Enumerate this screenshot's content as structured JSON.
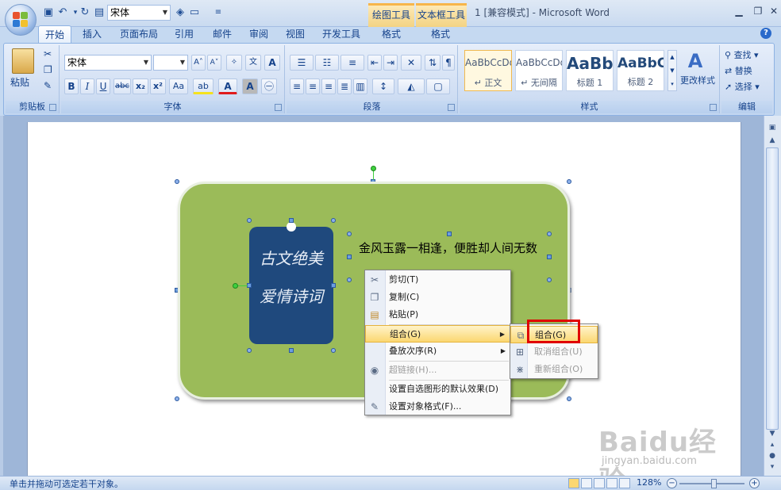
{
  "window": {
    "title": "1 [兼容模式] - Microsoft Word",
    "controls": [
      "minimize",
      "restore",
      "close"
    ]
  },
  "quick_access": {
    "font_value": "宋体"
  },
  "contextual_tools": {
    "drawing_tools": "绘图工具",
    "textbox_tools": "文本框工具",
    "format_label_1": "格式",
    "format_label_2": "格式"
  },
  "tabs": [
    "开始",
    "插入",
    "页面布局",
    "引用",
    "邮件",
    "审阅",
    "视图",
    "开发工具"
  ],
  "ribbon": {
    "clipboard": {
      "paste_label": "粘贴",
      "group_label": "剪贴板"
    },
    "font": {
      "font_name": "宋体",
      "font_size": "",
      "group_label": "字体",
      "bold": "B",
      "italic": "I",
      "underline": "U",
      "strike": "abc",
      "subscript": "x₂",
      "superscript": "x²",
      "change_case": "Aa",
      "font_color": "A",
      "char_shading": "A"
    },
    "paragraph": {
      "group_label": "段落"
    },
    "styles": {
      "group_label": "样式",
      "items": [
        {
          "sample": "AaBbCcDd",
          "name": "↵ 正文"
        },
        {
          "sample": "AaBbCcDd",
          "name": "↵ 无间隔"
        },
        {
          "sample": "AaBb",
          "name": "标题 1"
        },
        {
          "sample": "AaBbC",
          "name": "标题 2"
        }
      ],
      "change_styles": "更改样式"
    },
    "editing": {
      "group_label": "编辑",
      "find": "查找",
      "replace": "替换",
      "select": "选择"
    }
  },
  "document": {
    "poem_line_1": "古文绝美",
    "poem_line_2": "爱情诗词",
    "textbox_text": "金风玉露一相逢，便胜却人间无数"
  },
  "context_menu": {
    "items": [
      {
        "label": "剪切(T)",
        "icon": "cut-icon",
        "enabled": true,
        "submenu": false
      },
      {
        "label": "复制(C)",
        "icon": "copy-icon",
        "enabled": true,
        "submenu": false
      },
      {
        "label": "粘贴(P)",
        "icon": "paste-icon",
        "enabled": true,
        "submenu": false
      },
      {
        "label": "组合(G)",
        "icon": "",
        "enabled": true,
        "submenu": true,
        "highlighted": true
      },
      {
        "label": "叠放次序(R)",
        "icon": "",
        "enabled": true,
        "submenu": true
      },
      {
        "label": "超链接(H)...",
        "icon": "hyperlink-icon",
        "enabled": false,
        "submenu": false
      },
      {
        "label": "设置自选图形的默认效果(D)",
        "icon": "",
        "enabled": true,
        "submenu": false
      },
      {
        "label": "设置对象格式(F)...",
        "icon": "format-object-icon",
        "enabled": true,
        "submenu": false
      }
    ]
  },
  "sub_menu": {
    "items": [
      {
        "label": "组合(G)",
        "icon": "group-icon",
        "enabled": true,
        "highlighted": true
      },
      {
        "label": "取消组合(U)",
        "icon": "ungroup-icon",
        "enabled": false
      },
      {
        "label": "重新组合(O)",
        "icon": "regroup-icon",
        "enabled": false
      }
    ]
  },
  "watermark": {
    "brand": "Baidu经验",
    "url": "jingyan.baidu.com"
  },
  "statusbar": {
    "text": "单击并拖动可选定若干对象。",
    "zoom": "128%",
    "zoom_level_percent": 128
  },
  "colors": {
    "green_shape": "#9bbb59",
    "blue_shape": "#1f497d",
    "highlight": "#fbd771",
    "red_box": "#e00000"
  }
}
